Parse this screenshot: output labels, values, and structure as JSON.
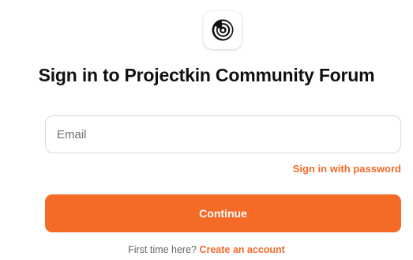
{
  "logo": {
    "icon": "spiral-logo-icon"
  },
  "title": "Sign in to Projectkin Community Forum",
  "email": {
    "placeholder": "Email",
    "value": ""
  },
  "links": {
    "sign_in_with_password": "Sign in with password"
  },
  "buttons": {
    "continue_label": "Continue"
  },
  "footer": {
    "prompt": "First time here?",
    "create_account": "Create an account"
  },
  "colors": {
    "accent": "#f46a27",
    "link": "#f26a2a",
    "title": "#111111"
  }
}
